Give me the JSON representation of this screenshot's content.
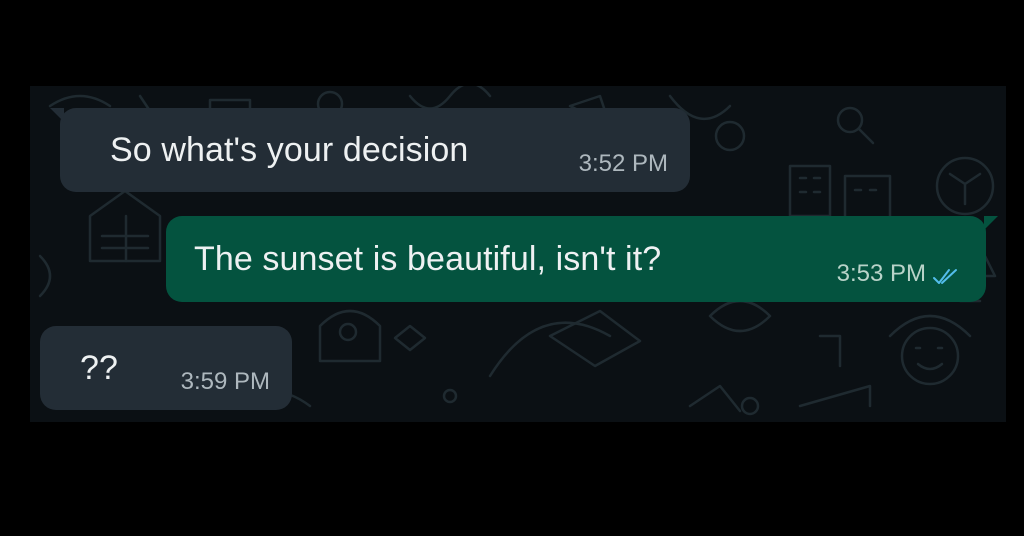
{
  "messages": [
    {
      "direction": "incoming",
      "text": "So what's your decision",
      "time": "3:52 PM"
    },
    {
      "direction": "outgoing",
      "text": "The sunset is beautiful, isn't it?",
      "time": "3:53 PM",
      "status_icon": "double-check-read-icon"
    },
    {
      "direction": "incoming",
      "text": "??",
      "time": "3:59 PM"
    }
  ],
  "colors": {
    "page_background": "#000000",
    "chat_background": "#0b1014",
    "incoming_bubble": "#232d36",
    "outgoing_bubble": "#04533f",
    "message_text": "#eef1f2",
    "read_ticks": "#53bdeb"
  }
}
